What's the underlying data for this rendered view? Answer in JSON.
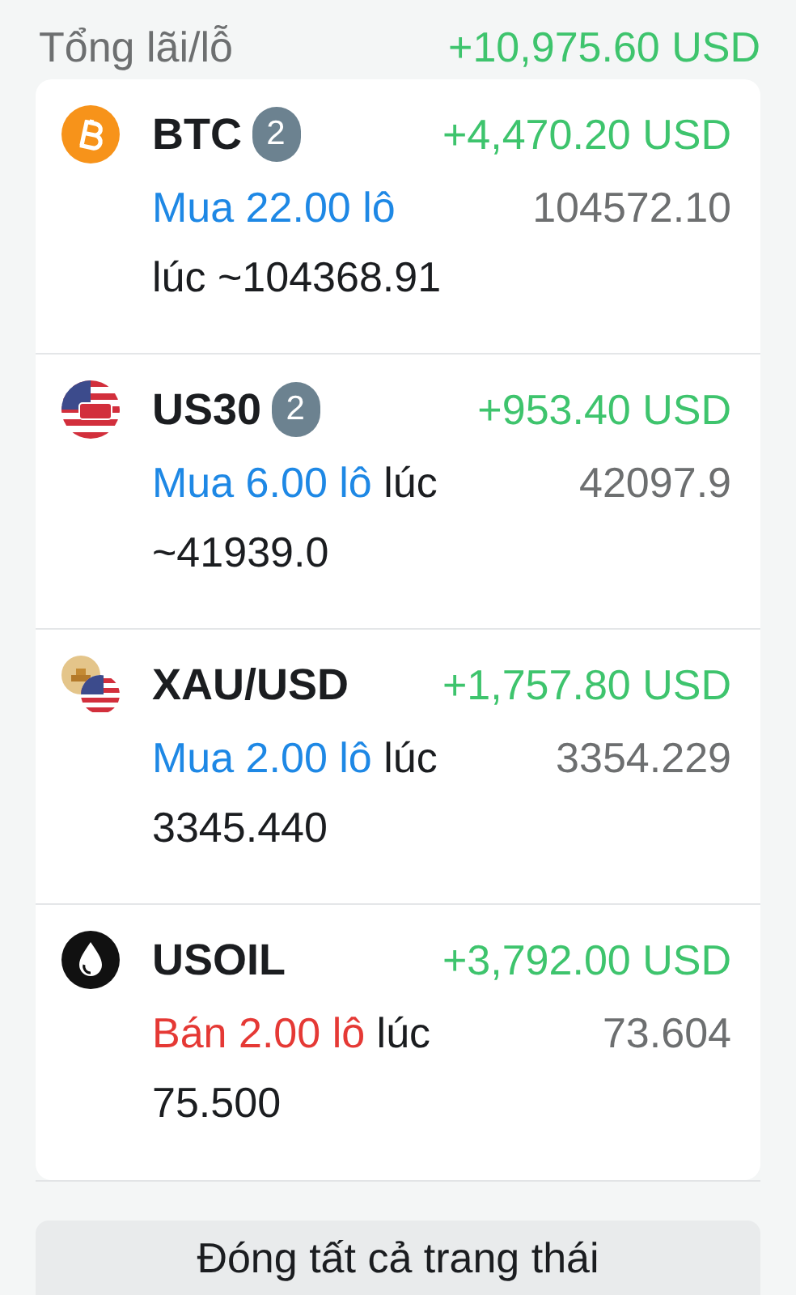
{
  "total": {
    "label": "Tổng lãi/lỗ",
    "value": "+10,975.60 USD"
  },
  "positions": [
    {
      "kind": "bitcoin",
      "symbol": "BTC",
      "count": "2",
      "profit": "+4,470.20 USD",
      "sell": false,
      "action": "Mua 22.00 lô",
      "at": "lúc ~104368.91",
      "price": "104572.10"
    },
    {
      "kind": "index",
      "symbol": "US30",
      "count": "2",
      "profit": "+953.40 USD",
      "sell": false,
      "action": "Mua 6.00 lô",
      "at": "lúc ~41939.0",
      "price": "42097.9"
    },
    {
      "kind": "metal",
      "symbol": "XAU/USD",
      "profit": "+1,757.80 USD",
      "sell": false,
      "action": "Mua 2.00 lô",
      "at": "lúc 3345.440",
      "price": "3354.229"
    },
    {
      "kind": "oil",
      "symbol": "USOIL",
      "profit": "+3,792.00 USD",
      "sell": true,
      "action": "Bán 2.00 lô",
      "at": "lúc 75.500",
      "price": "73.604"
    }
  ],
  "close_all_button": "Đóng tất cả trang thái"
}
